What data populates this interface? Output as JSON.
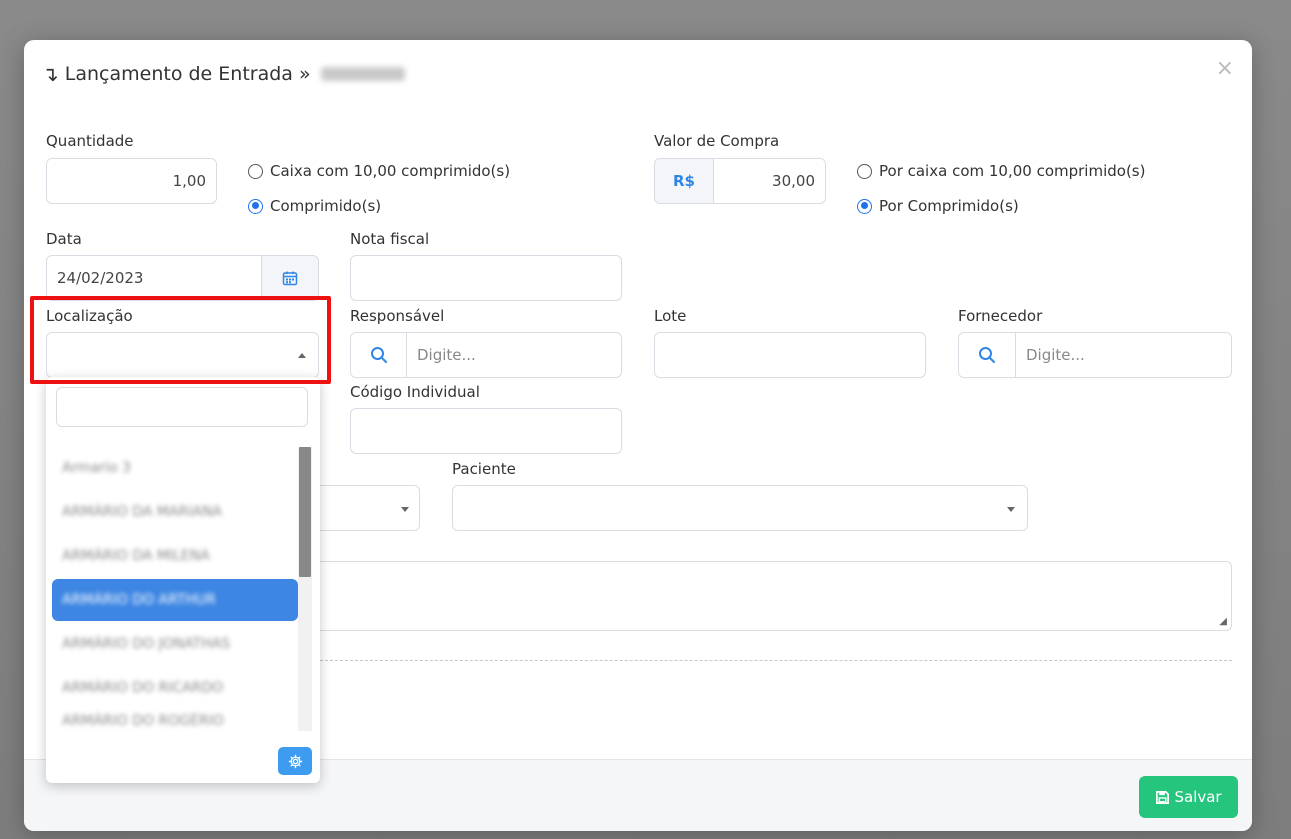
{
  "modal": {
    "title_arrow": "↴",
    "title": "Lançamento de Entrada »",
    "close": "×"
  },
  "form": {
    "quantidade": {
      "label": "Quantidade",
      "value": "1,00"
    },
    "qty_unit": {
      "option_box": "Caixa com 10,00 comprimido(s)",
      "option_unit": "Comprimido(s)",
      "selected": "Comprimido(s)"
    },
    "valor_compra": {
      "label": "Valor de Compra",
      "currency": "R$",
      "value": "30,00"
    },
    "price_unit": {
      "option_box": "Por caixa com 10,00 comprimido(s)",
      "option_unit": "Por Comprimido(s)",
      "selected": "Por Comprimido(s)"
    },
    "data": {
      "label": "Data",
      "value": "24/02/2023"
    },
    "nota_fiscal": {
      "label": "Nota fiscal",
      "value": ""
    },
    "localizacao": {
      "label": "Localização",
      "value": ""
    },
    "responsavel": {
      "label": "Responsável",
      "placeholder": "Digite..."
    },
    "lote": {
      "label": "Lote",
      "value": ""
    },
    "fornecedor": {
      "label": "Fornecedor",
      "placeholder": "Digite..."
    },
    "codigo_individual": {
      "label": "Código Individual",
      "value": ""
    },
    "paciente": {
      "label": "Paciente",
      "value": ""
    }
  },
  "dropdown": {
    "search_value": "",
    "options": [
      "Armario 3",
      "ARMÁRIO DA MARIANA",
      "ARMÁRIO DA MILENA",
      "ARMÁRIO DO ARTHUR",
      "ARMÁRIO DO JONATHAS",
      "ARMÁRIO DO RICARDO",
      "ARMÁRIO DO ROGÉRIO"
    ],
    "active_index": 3
  },
  "footer": {
    "save_label": "Salvar"
  },
  "colors": {
    "accent": "#3d86e3",
    "save": "#26c57e",
    "highlight": "#ee1111"
  },
  "icons": {
    "calendar": "calendar-icon",
    "search": "search-icon",
    "gear": "gear-icon",
    "save": "save-icon"
  }
}
